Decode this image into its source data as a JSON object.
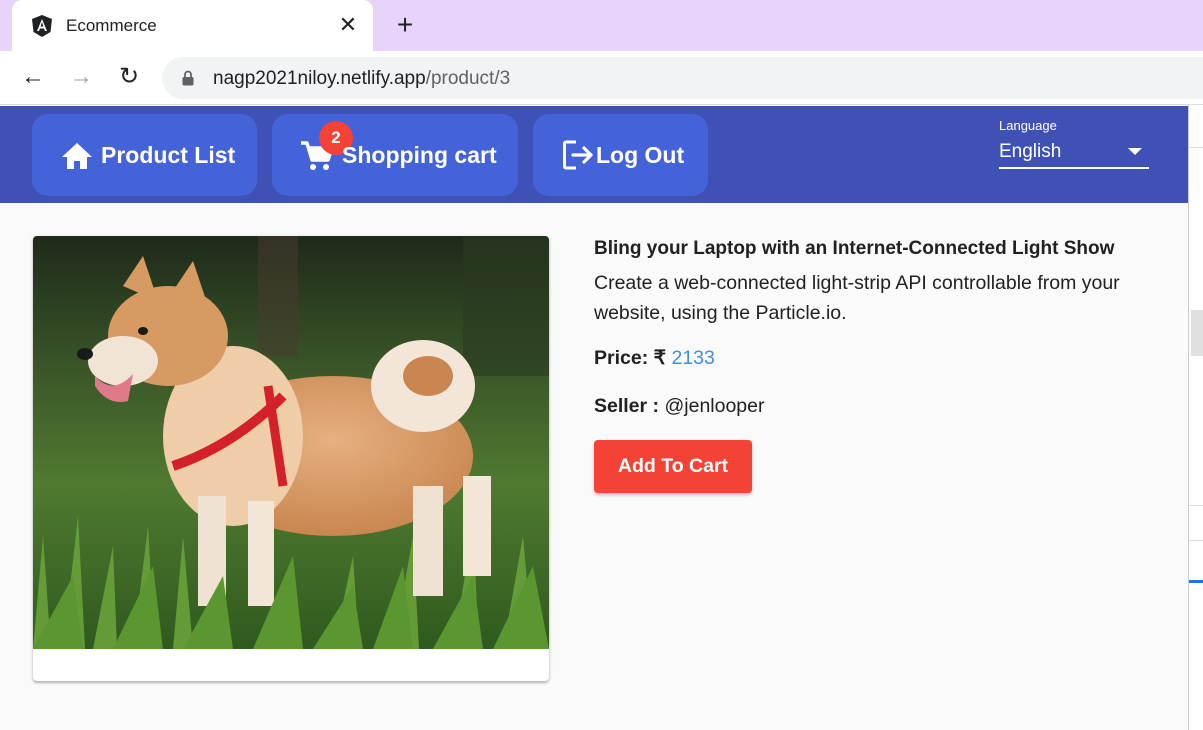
{
  "browser": {
    "tab_title": "Ecommerce",
    "tab_favicon": "angular-icon",
    "url_domain": "nagp2021niloy.netlify.app",
    "url_path": "/product/3"
  },
  "header": {
    "product_list_label": "Product List",
    "shopping_cart_label": "Shopping cart",
    "cart_count": "2",
    "logout_label": "Log Out",
    "language_label": "Language",
    "language_value": "English",
    "colors": {
      "header_bg": "#3f51b5",
      "button_bg": "#4563d8",
      "badge": "#f44336"
    }
  },
  "product": {
    "image_alt": "Shiba Inu dog standing in grass wearing a red harness",
    "title": "Bling your Laptop with an Internet-Connected Light Show",
    "description": "Create a web-connected light-strip API controllable from your website, using the Particle.io.",
    "price_label": "Price:",
    "currency_symbol": "₹",
    "price_value": "2133",
    "seller_label": "Seller :",
    "seller_value": "@jenlooper",
    "add_to_cart_label": "Add To Cart"
  }
}
